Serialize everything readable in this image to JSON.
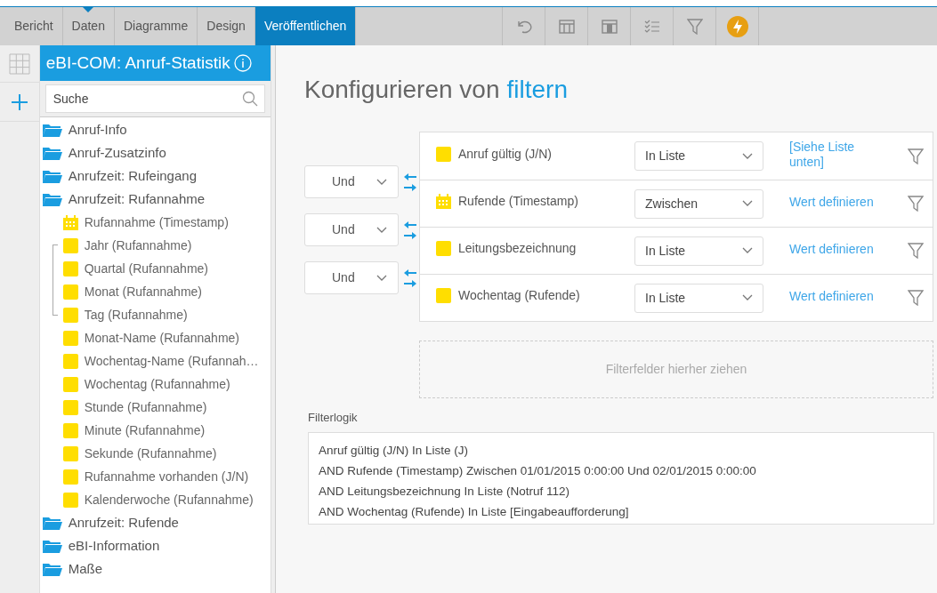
{
  "top_tabs": [
    {
      "label": "Bericht",
      "selected": false,
      "pointer": false
    },
    {
      "label": "Daten",
      "selected": false,
      "pointer": true
    },
    {
      "label": "Diagramme",
      "selected": false,
      "pointer": false
    },
    {
      "label": "Design",
      "selected": false,
      "pointer": false
    },
    {
      "label": "Veröffentlichen",
      "selected": true,
      "pointer": false
    }
  ],
  "toolbar": [
    {
      "kind": "undo"
    },
    {
      "kind": "table"
    },
    {
      "kind": "columns"
    },
    {
      "kind": "checklist"
    },
    {
      "kind": "filter"
    },
    {
      "kind": "bolt"
    }
  ],
  "sidebar": {
    "title": "eBI-COM: Anruf-Statistik",
    "search": {
      "placeholder": "Suche"
    },
    "tree": [
      {
        "label": "Anruf-Info",
        "kind": "folder"
      },
      {
        "label": "Anruf-Zusatzinfo",
        "kind": "folder"
      },
      {
        "label": "Anrufzeit: Rufeingang",
        "kind": "folder"
      },
      {
        "label": "Anrufzeit: Rufannahme",
        "kind": "folder",
        "children": [
          {
            "label": "Rufannahme (Timestamp)",
            "kind": "date",
            "children": [
              {
                "label": "Jahr (Rufannahme)",
                "kind": "field"
              },
              {
                "label": "Quartal (Rufannahme)",
                "kind": "field"
              },
              {
                "label": "Monat (Rufannahme)",
                "kind": "field"
              },
              {
                "label": "Tag (Rufannahme)",
                "kind": "field"
              }
            ]
          },
          {
            "label": "Monat-Name (Rufannahme)",
            "kind": "field"
          },
          {
            "label": "Wochentag-Name (Rufannah…",
            "kind": "field"
          },
          {
            "label": "Wochentag (Rufannahme)",
            "kind": "field"
          },
          {
            "label": "Stunde (Rufannahme)",
            "kind": "field"
          },
          {
            "label": "Minute (Rufannahme)",
            "kind": "field"
          },
          {
            "label": "Sekunde (Rufannahme)",
            "kind": "field"
          },
          {
            "label": "Rufannahme vorhanden (J/N)",
            "kind": "field"
          },
          {
            "label": "Kalenderwoche (Rufannahme)",
            "kind": "field"
          }
        ]
      },
      {
        "label": "Anrufzeit: Rufende",
        "kind": "folder"
      },
      {
        "label": "eBI-Information",
        "kind": "folder"
      },
      {
        "label": "Maße",
        "kind": "folder"
      }
    ]
  },
  "main": {
    "title": "Konfigurieren von",
    "title_highlight": "filtern",
    "filters": [
      {
        "field": "Anruf gültig (J/N)",
        "kind": "field",
        "operator": "In Liste",
        "value": "[Siehe Liste unten]"
      },
      {
        "field": "Rufende (Timestamp)",
        "kind": "date",
        "operator": "Zwischen",
        "value": "Wert definieren"
      },
      {
        "field": "Leitungsbezeichnung",
        "kind": "field",
        "operator": "In Liste",
        "value": "Wert definieren"
      },
      {
        "field": "Wochentag (Rufende)",
        "kind": "field",
        "operator": "In Liste",
        "value": "Wert definieren"
      }
    ],
    "connectors": [
      "Und",
      "Und",
      "Und"
    ],
    "drop_zone": "Filterfelder hierher ziehen",
    "logic_label": "Filterlogik",
    "logic_lines": [
      "Anruf gültig (J/N) In Liste (J)",
      "AND Rufende (Timestamp) Zwischen 01/01/2015 0:00:00 Und 02/01/2015 0:00:00",
      "AND Leitungsbezeichnung In Liste (Notruf 112)",
      "AND Wochentag (Rufende) In Liste [Eingabeaufforderung]"
    ]
  }
}
